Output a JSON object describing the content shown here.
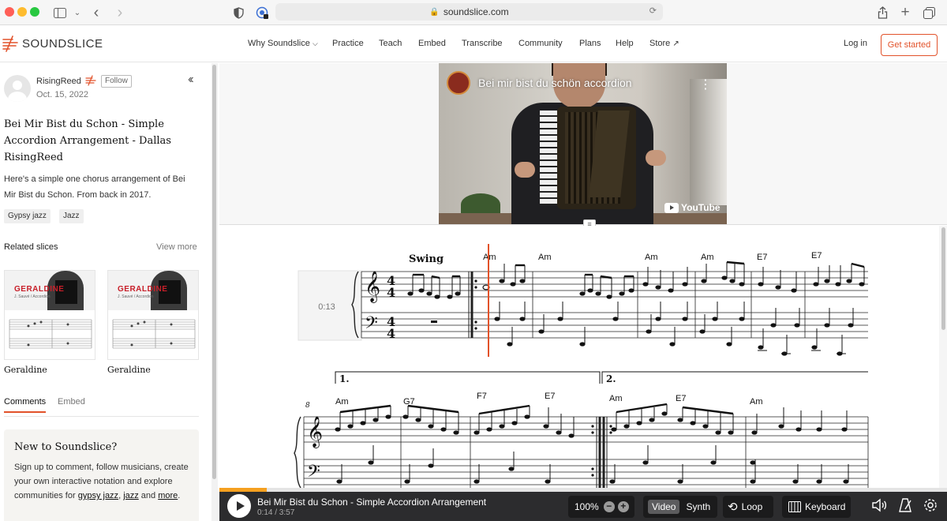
{
  "browser": {
    "url": "soundslice.com"
  },
  "site": {
    "logo_text": "SOUNDSLICE",
    "nav": [
      "Why Soundslice",
      "Practice",
      "Teach",
      "Embed",
      "Transcribe",
      "Community",
      "Plans",
      "Help",
      "Store"
    ],
    "login": "Log in",
    "get_started": "Get started",
    "accent_color": "#e2522a"
  },
  "sidebar": {
    "username": "RisingReed",
    "follow_label": "Follow",
    "date": "Oct. 15, 2022",
    "title": "Bei Mir Bist du Schon - Simple Accordion Arrangement - Dallas RisingReed",
    "description": "Here's a simple one chorus arrangement of Bei Mir Bist du Schon. From back in 2017.",
    "tags": [
      "Gypsy jazz",
      "Jazz"
    ],
    "related_heading": "Related slices",
    "view_more": "View more",
    "related": [
      {
        "card_title": "GERALDINE",
        "card_sub": "J. Sauvé / Accordion",
        "label": "Geraldine"
      },
      {
        "card_title": "GERALDINE",
        "card_sub": "J. Sauvé / Accordion",
        "label": "Geraldine"
      }
    ],
    "tabs": [
      "Comments",
      "Embed"
    ],
    "newbox": {
      "heading": "New to Soundslice?",
      "text_1": "Sign up to comment, follow musicians, create your own interactive notation and explore communities for ",
      "link_1": "gypsy jazz",
      "sep": ", ",
      "link_2": "jazz",
      "text_2": " and ",
      "link_3": "more",
      "text_3": "."
    }
  },
  "video": {
    "title": "Bei mir bist du schön accordion",
    "youtube": "YouTube",
    "divider_icon": "≡"
  },
  "notation": {
    "tempo_mark": "Swing",
    "time_marker": "0:13",
    "measure_number": "8",
    "volta_1": "1.",
    "volta_2": "2.",
    "row1_chords": [
      "Am",
      "Am",
      "Am",
      "Am",
      "E7",
      "E7"
    ],
    "row2_chords": [
      "Am",
      "G7",
      "F7",
      "E7",
      "Am",
      "E7",
      "Am"
    ]
  },
  "player": {
    "title": "Bei Mir Bist du Schon - Simple Accordion Arrangement",
    "time": "0:14 / 3:57",
    "progress": 0.065,
    "zoom": "100%",
    "video_label": "Video",
    "synth_label": "Synth",
    "loop_label": "Loop",
    "keyboard_label": "Keyboard"
  }
}
